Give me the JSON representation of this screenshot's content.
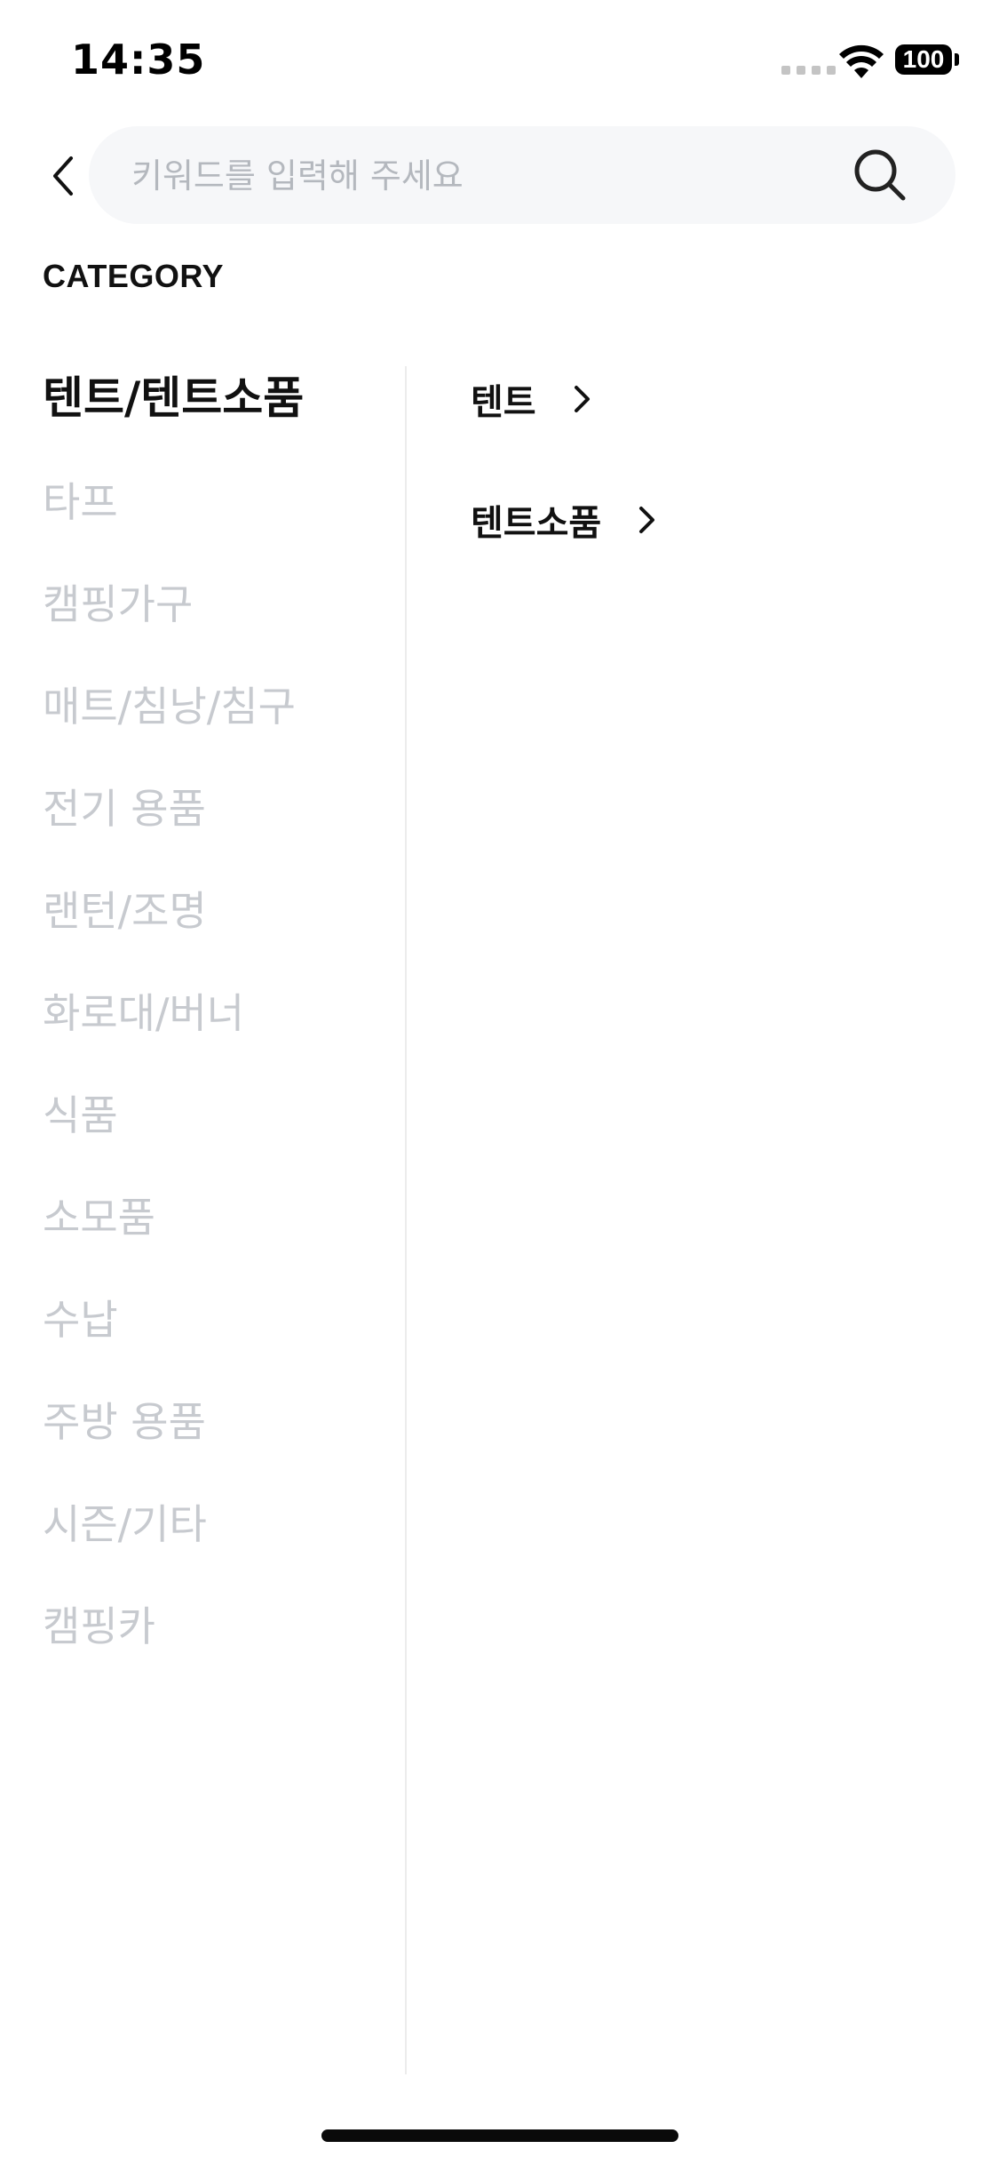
{
  "status_bar": {
    "time": "14:35",
    "battery": "100"
  },
  "search": {
    "placeholder": "키워드를 입력해 주세요",
    "value": ""
  },
  "category_heading": "CATEGORY",
  "categories": [
    {
      "label": "텐트/텐트소품",
      "selected": true
    },
    {
      "label": "타프",
      "selected": false
    },
    {
      "label": "캠핑가구",
      "selected": false
    },
    {
      "label": "매트/침낭/침구",
      "selected": false
    },
    {
      "label": "전기 용품",
      "selected": false
    },
    {
      "label": "랜턴/조명",
      "selected": false
    },
    {
      "label": "화로대/버너",
      "selected": false
    },
    {
      "label": "식품",
      "selected": false
    },
    {
      "label": "소모품",
      "selected": false
    },
    {
      "label": "수납",
      "selected": false
    },
    {
      "label": "주방 용품",
      "selected": false
    },
    {
      "label": "시즌/기타",
      "selected": false
    },
    {
      "label": "캠핑카",
      "selected": false
    }
  ],
  "subcategories": [
    {
      "label": "텐트"
    },
    {
      "label": "텐트소품"
    }
  ],
  "colors": {
    "active": "#111111",
    "inactive": "#c7cacf",
    "search_bg": "#f6f7f9",
    "divider": "#ececec"
  },
  "icons": {
    "back": "chevron-left-icon",
    "search": "search-icon",
    "sub": "chevron-right-icon"
  }
}
